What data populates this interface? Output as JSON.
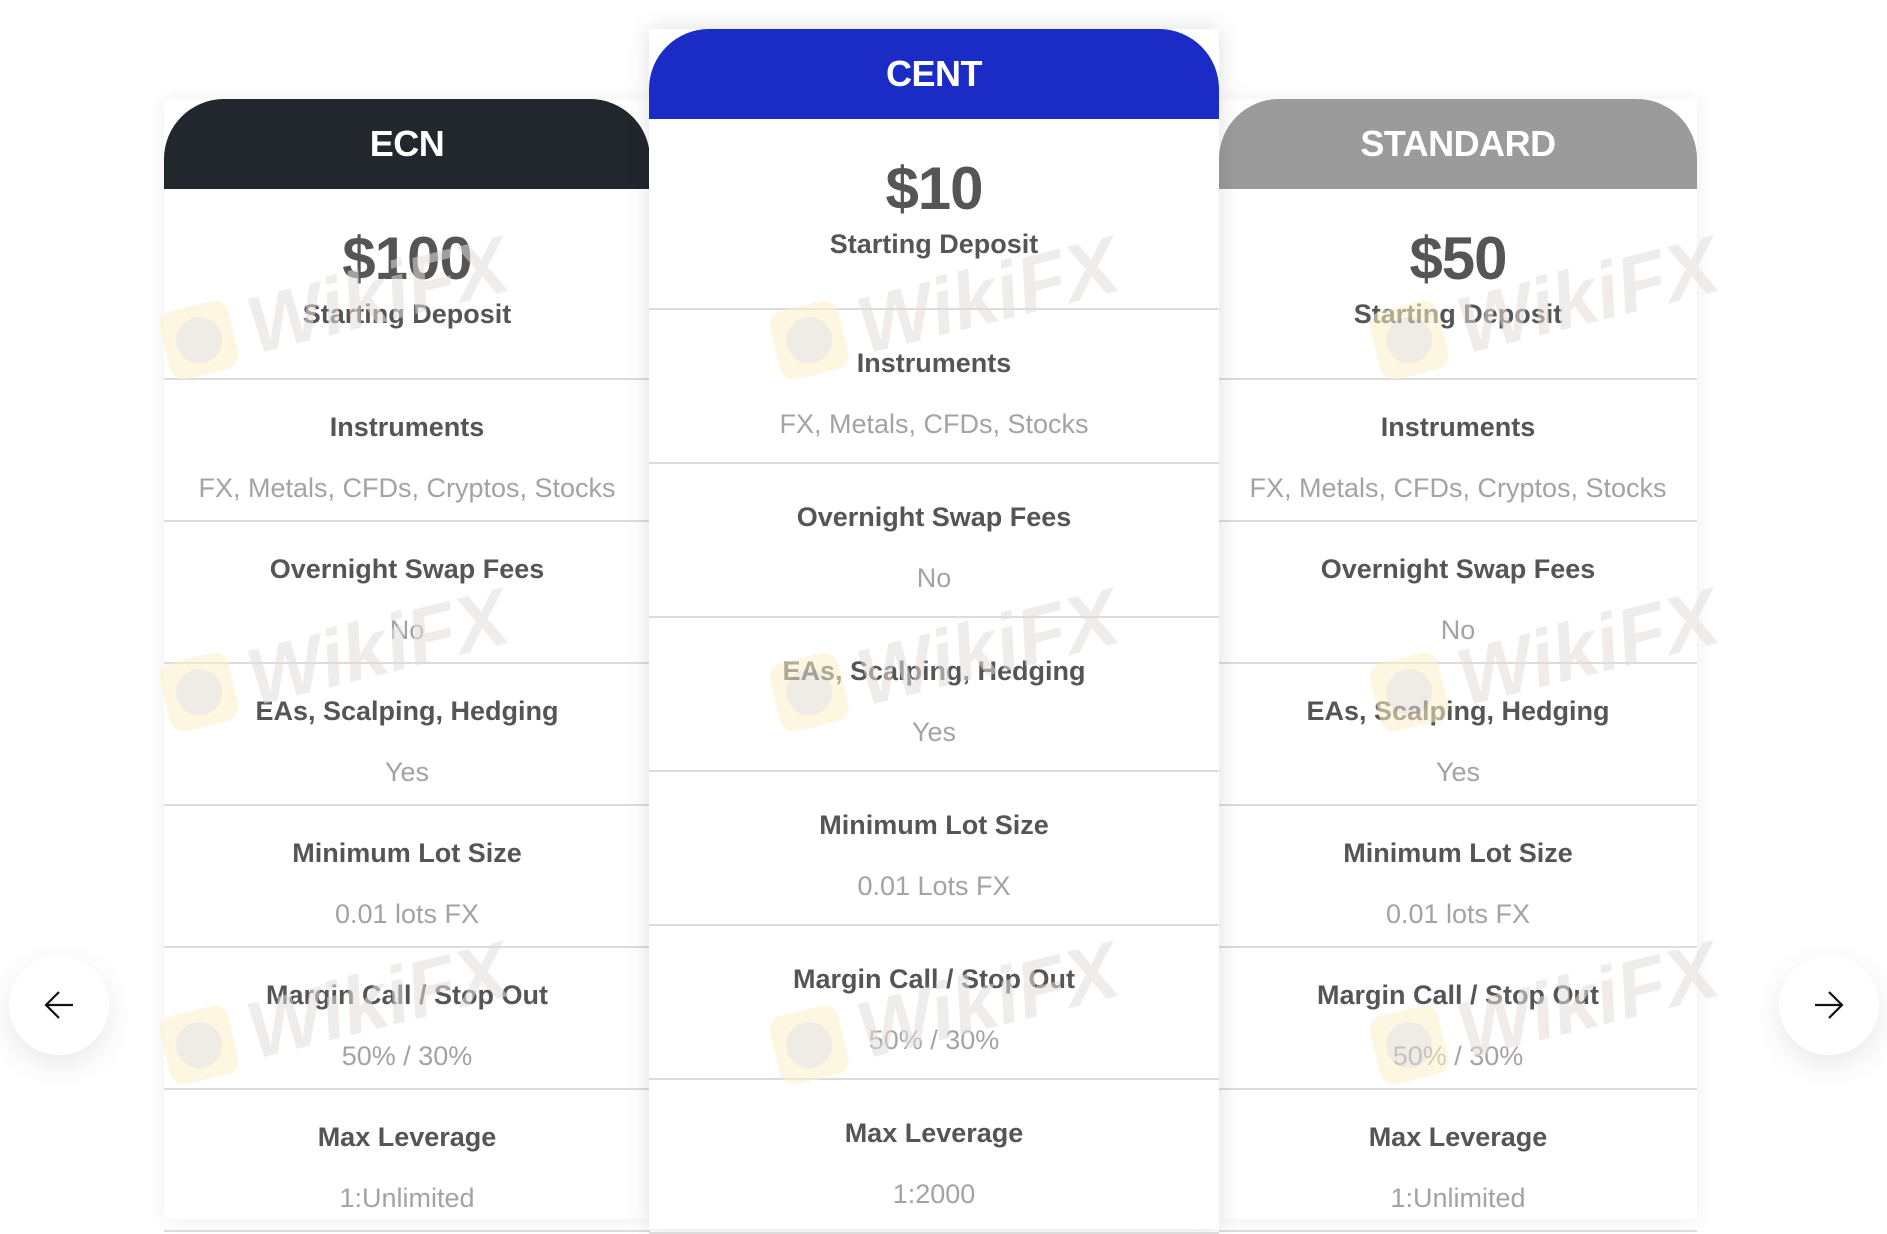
{
  "accounts": [
    {
      "name": "ECN",
      "header_color": "#22262d",
      "deposit_amount": "$100",
      "deposit_label": "Starting Deposit",
      "features": [
        {
          "title": "Instruments",
          "value": "FX, Metals, CFDs, Cryptos, Stocks"
        },
        {
          "title": "Overnight Swap Fees",
          "value": "No"
        },
        {
          "title": "EAs, Scalping, Hedging",
          "value": "Yes"
        },
        {
          "title": "Minimum Lot Size",
          "value": "0.01 lots FX"
        },
        {
          "title": "Margin Call / Stop Out",
          "value": "50% / 30%"
        },
        {
          "title": "Max Leverage",
          "value": "1:Unlimited"
        }
      ]
    },
    {
      "name": "CENT",
      "header_color": "#1b2bc6",
      "deposit_amount": "$10",
      "deposit_label": "Starting Deposit",
      "features": [
        {
          "title": "Instruments",
          "value": "FX, Metals, CFDs, Stocks"
        },
        {
          "title": "Overnight Swap Fees",
          "value": "No"
        },
        {
          "title": "EAs, Scalping, Hedging",
          "value": "Yes"
        },
        {
          "title": "Minimum Lot Size",
          "value": "0.01 Lots FX"
        },
        {
          "title": "Margin Call / Stop Out",
          "value": "50% / 30%"
        },
        {
          "title": "Max Leverage",
          "value": "1:2000"
        }
      ]
    },
    {
      "name": "STANDARD",
      "header_color": "#9b9b9b",
      "deposit_amount": "$50",
      "deposit_label": "Starting Deposit",
      "features": [
        {
          "title": "Instruments",
          "value": "FX, Metals, CFDs, Cryptos, Stocks"
        },
        {
          "title": "Overnight Swap Fees",
          "value": "No"
        },
        {
          "title": "EAs, Scalping, Hedging",
          "value": "Yes"
        },
        {
          "title": "Minimum Lot Size",
          "value": "0.01 lots FX"
        },
        {
          "title": "Margin Call / Stop Out",
          "value": "50% / 30%"
        },
        {
          "title": "Max Leverage",
          "value": "1:Unlimited"
        }
      ]
    }
  ],
  "navigation": {
    "prev_icon": "arrow-left-icon",
    "next_icon": "arrow-right-icon"
  },
  "watermark": {
    "text": "WikiFX"
  }
}
